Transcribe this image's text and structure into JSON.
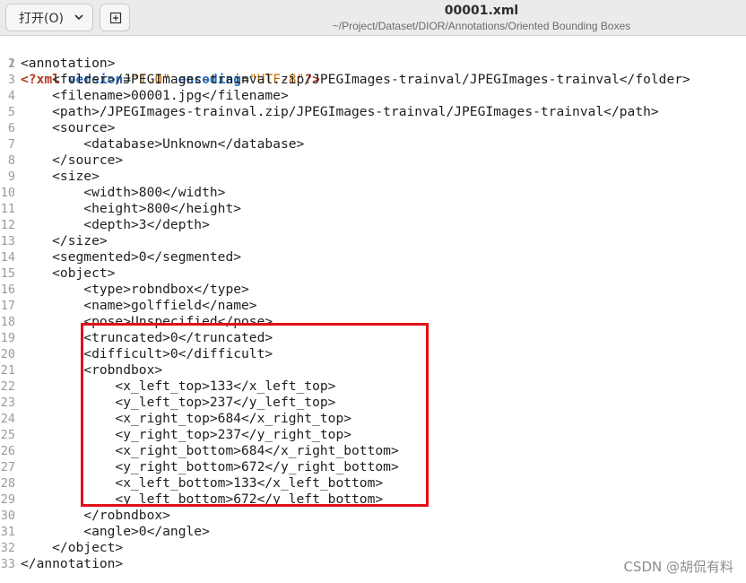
{
  "toolbar": {
    "open_label": "打开(O)",
    "open_icon": "chevron-down-icon",
    "new_doc_icon": "new-document-icon"
  },
  "document": {
    "title": "00001.xml",
    "path": "~/Project/Dataset/DIOR/Annotations/Oriented Bounding Boxes"
  },
  "editor": {
    "lines": [
      {
        "n": "1",
        "text": "<?xml version=\"1.0\" encoding=\"UTF-8\"?>"
      },
      {
        "n": "2",
        "text": "<annotation>"
      },
      {
        "n": "3",
        "text": "    <folder>/JPEGImages-trainval.zip/JPEGImages-trainval/JPEGImages-trainval</folder>"
      },
      {
        "n": "4",
        "text": "    <filename>00001.jpg</filename>"
      },
      {
        "n": "5",
        "text": "    <path>/JPEGImages-trainval.zip/JPEGImages-trainval/JPEGImages-trainval</path>"
      },
      {
        "n": "6",
        "text": "    <source>"
      },
      {
        "n": "7",
        "text": "        <database>Unknown</database>"
      },
      {
        "n": "8",
        "text": "    </source>"
      },
      {
        "n": "9",
        "text": "    <size>"
      },
      {
        "n": "10",
        "text": "        <width>800</width>"
      },
      {
        "n": "11",
        "text": "        <height>800</height>"
      },
      {
        "n": "12",
        "text": "        <depth>3</depth>"
      },
      {
        "n": "13",
        "text": "    </size>"
      },
      {
        "n": "14",
        "text": "    <segmented>0</segmented>"
      },
      {
        "n": "15",
        "text": "    <object>"
      },
      {
        "n": "16",
        "text": "        <type>robndbox</type>"
      },
      {
        "n": "17",
        "text": "        <name>golffield</name>"
      },
      {
        "n": "18",
        "text": "        <pose>Unspecified</pose>"
      },
      {
        "n": "19",
        "text": "        <truncated>0</truncated>"
      },
      {
        "n": "20",
        "text": "        <difficult>0</difficult>"
      },
      {
        "n": "21",
        "text": "        <robndbox>"
      },
      {
        "n": "22",
        "text": "            <x_left_top>133</x_left_top>"
      },
      {
        "n": "23",
        "text": "            <y_left_top>237</y_left_top>"
      },
      {
        "n": "24",
        "text": "            <x_right_top>684</x_right_top>"
      },
      {
        "n": "25",
        "text": "            <y_right_top>237</y_right_top>"
      },
      {
        "n": "26",
        "text": "            <x_right_bottom>684</x_right_bottom>"
      },
      {
        "n": "27",
        "text": "            <y_right_bottom>672</y_right_bottom>"
      },
      {
        "n": "28",
        "text": "            <x_left_bottom>133</x_left_bottom>"
      },
      {
        "n": "29",
        "text": "            <y_left_bottom>672</y_left_bottom>"
      },
      {
        "n": "30",
        "text": "        </robndbox>"
      },
      {
        "n": "31",
        "text": "        <angle>0</angle>"
      },
      {
        "n": "32",
        "text": "    </object>"
      },
      {
        "n": "33",
        "text": "</annotation>"
      }
    ],
    "xml_decl": {
      "open": "<?",
      "name": "xml",
      "attr1": "version",
      "val1": "\"1.0\"",
      "attr2": "encoding",
      "val2": "\"UTF-8\"",
      "close": "?>"
    }
  },
  "highlight_color": "#e0101a",
  "watermark": "CSDN @胡侃有料"
}
